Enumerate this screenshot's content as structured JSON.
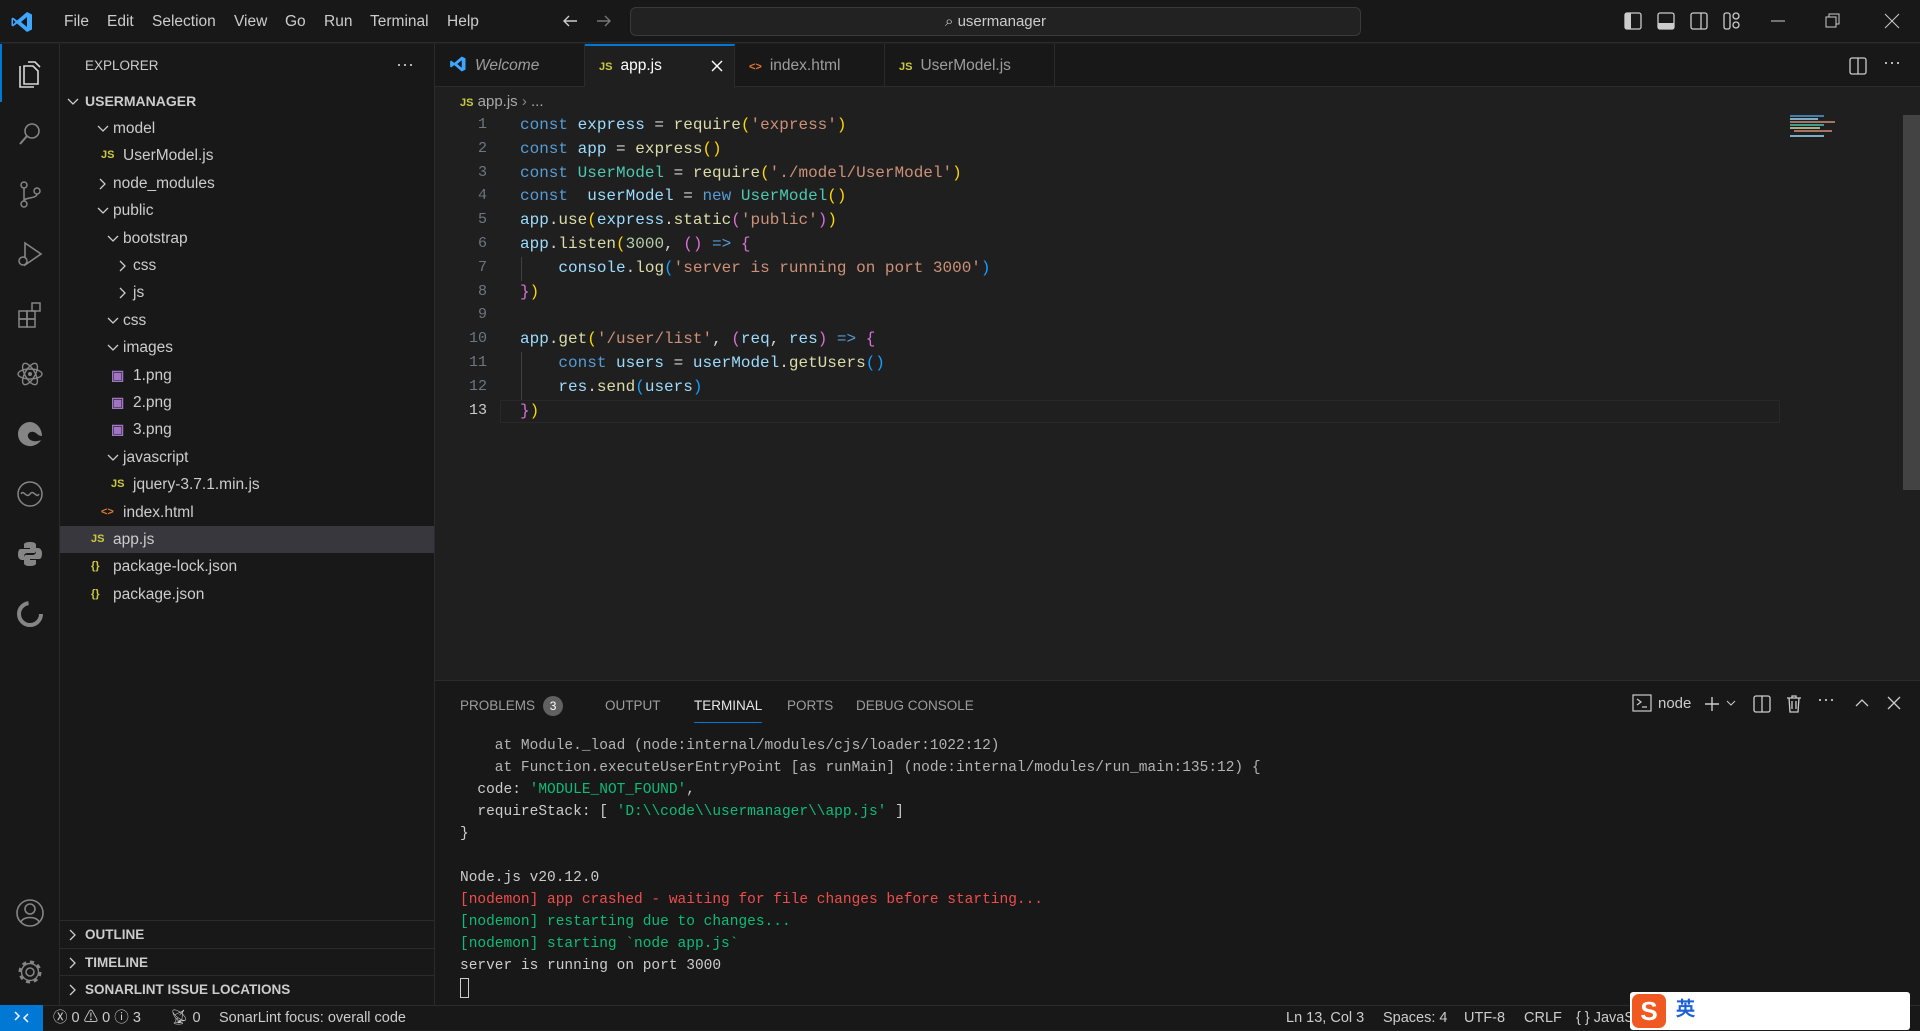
{
  "titlebar": {
    "menu": [
      "File",
      "Edit",
      "Selection",
      "View",
      "Go",
      "Run",
      "Terminal",
      "Help"
    ],
    "search": "usermanager"
  },
  "activity": [
    "explorer-icon",
    "search-icon",
    "source-control-icon",
    "run-debug-icon",
    "extensions-icon",
    "react-icon",
    "edge-icon",
    "live-share-icon",
    "python-icon",
    "sonarlint-icon"
  ],
  "sidebar": {
    "title": "EXPLORER",
    "root": "USERMANAGER",
    "items": [
      {
        "label": "model",
        "depth": 1,
        "type": "folder",
        "open": true
      },
      {
        "label": "UserModel.js",
        "depth": 2,
        "type": "js"
      },
      {
        "label": "node_modules",
        "depth": 1,
        "type": "folder",
        "open": false
      },
      {
        "label": "public",
        "depth": 1,
        "type": "folder",
        "open": true
      },
      {
        "label": "bootstrap",
        "depth": 2,
        "type": "folder",
        "open": true
      },
      {
        "label": "css",
        "depth": 3,
        "type": "folder",
        "open": false
      },
      {
        "label": "js",
        "depth": 3,
        "type": "folder",
        "open": false
      },
      {
        "label": "css",
        "depth": 2,
        "type": "folder",
        "open": true
      },
      {
        "label": "images",
        "depth": 2,
        "type": "folder",
        "open": true
      },
      {
        "label": "1.png",
        "depth": 3,
        "type": "png"
      },
      {
        "label": "2.png",
        "depth": 3,
        "type": "png"
      },
      {
        "label": "3.png",
        "depth": 3,
        "type": "png"
      },
      {
        "label": "javascript",
        "depth": 2,
        "type": "folder",
        "open": true
      },
      {
        "label": "jquery-3.7.1.min.js",
        "depth": 3,
        "type": "js"
      },
      {
        "label": "index.html",
        "depth": 2,
        "type": "html"
      },
      {
        "label": "app.js",
        "depth": 1,
        "type": "js",
        "selected": true
      },
      {
        "label": "package-lock.json",
        "depth": 1,
        "type": "json"
      },
      {
        "label": "package.json",
        "depth": 1,
        "type": "json"
      }
    ],
    "sections": [
      "OUTLINE",
      "TIMELINE",
      "SONARLINT ISSUE LOCATIONS"
    ]
  },
  "tabs": [
    {
      "label": "Welcome",
      "type": "vscode"
    },
    {
      "label": "app.js",
      "type": "js",
      "active": true
    },
    {
      "label": "index.html",
      "type": "html"
    },
    {
      "label": "UserModel.js",
      "type": "js"
    }
  ],
  "breadcrumb": {
    "file": "app.js",
    "rest": "..."
  },
  "editor": {
    "current_line": 13,
    "lines": [
      [
        [
          "const ",
          "k"
        ],
        [
          "express",
          "v"
        ],
        [
          " = ",
          "o"
        ],
        [
          "require",
          "f"
        ],
        [
          "(",
          "p1"
        ],
        [
          "'express'",
          "s"
        ],
        [
          ")",
          "p1"
        ]
      ],
      [
        [
          "const ",
          "k"
        ],
        [
          "app",
          "v"
        ],
        [
          " = ",
          "o"
        ],
        [
          "express",
          "f"
        ],
        [
          "()",
          "p1"
        ]
      ],
      [
        [
          "const ",
          "k"
        ],
        [
          "UserModel",
          "c"
        ],
        [
          " = ",
          "o"
        ],
        [
          "require",
          "f"
        ],
        [
          "(",
          "p1"
        ],
        [
          "'./model/UserModel'",
          "s"
        ],
        [
          ")",
          "p1"
        ]
      ],
      [
        [
          "const  ",
          "k"
        ],
        [
          "userModel",
          "v"
        ],
        [
          " = ",
          "o"
        ],
        [
          "new ",
          "k"
        ],
        [
          "UserModel",
          "c"
        ],
        [
          "()",
          "p1"
        ]
      ],
      [
        [
          "app",
          "v"
        ],
        [
          ".",
          "o"
        ],
        [
          "use",
          "f"
        ],
        [
          "(",
          "p1"
        ],
        [
          "express",
          "v"
        ],
        [
          ".",
          "o"
        ],
        [
          "static",
          "f"
        ],
        [
          "(",
          "p2"
        ],
        [
          "'public'",
          "s"
        ],
        [
          ")",
          "p2"
        ],
        [
          ")",
          "p1"
        ]
      ],
      [
        [
          "app",
          "v"
        ],
        [
          ".",
          "o"
        ],
        [
          "listen",
          "f"
        ],
        [
          "(",
          "p1"
        ],
        [
          "3000",
          "n"
        ],
        [
          ", ",
          "o"
        ],
        [
          "()",
          "p2"
        ],
        [
          " => ",
          "k"
        ],
        [
          "{",
          "p2"
        ]
      ],
      [
        [
          "    console",
          "v"
        ],
        [
          ".",
          "o"
        ],
        [
          "log",
          "f"
        ],
        [
          "(",
          "p3"
        ],
        [
          "'server is running on port 3000'",
          "s"
        ],
        [
          ")",
          "p3"
        ]
      ],
      [
        [
          "}",
          "p2"
        ],
        [
          ")",
          "p1"
        ]
      ],
      [],
      [
        [
          "app",
          "v"
        ],
        [
          ".",
          "o"
        ],
        [
          "get",
          "f"
        ],
        [
          "(",
          "p1"
        ],
        [
          "'/user/list'",
          "s"
        ],
        [
          ", ",
          "o"
        ],
        [
          "(",
          "p2"
        ],
        [
          "req",
          "v"
        ],
        [
          ", ",
          "o"
        ],
        [
          "res",
          "v"
        ],
        [
          ")",
          "p2"
        ],
        [
          " => ",
          "k"
        ],
        [
          "{",
          "p2"
        ]
      ],
      [
        [
          "    const ",
          "k"
        ],
        [
          "users",
          "v"
        ],
        [
          " = ",
          "o"
        ],
        [
          "userModel",
          "v"
        ],
        [
          ".",
          "o"
        ],
        [
          "getUsers",
          "f"
        ],
        [
          "()",
          "p3"
        ]
      ],
      [
        [
          "    res",
          "v"
        ],
        [
          ".",
          "o"
        ],
        [
          "send",
          "f"
        ],
        [
          "(",
          "p3"
        ],
        [
          "users",
          "v"
        ],
        [
          ")",
          "p3"
        ]
      ],
      [
        [
          "}",
          "p2"
        ],
        [
          ")",
          "p1"
        ]
      ]
    ]
  },
  "panel": {
    "tabs": [
      "PROBLEMS",
      "OUTPUT",
      "TERMINAL",
      "PORTS",
      "DEBUG CONSOLE"
    ],
    "problems_count": "3",
    "active": "TERMINAL",
    "terminal_name": "node",
    "lines": [
      [
        [
          "    at Module._load (node:internal/modules/cjs/loader:1022:12)",
          "t-dim"
        ]
      ],
      [
        [
          "    at Function.executeUserEntryPoint [as runMain] (node:internal/modules/run_main:135:12) {",
          "t-dim"
        ]
      ],
      [
        [
          "  code: ",
          ""
        ],
        [
          "'MODULE_NOT_FOUND'",
          "t-g2"
        ],
        [
          ",",
          ""
        ]
      ],
      [
        [
          "  requireStack: [ ",
          ""
        ],
        [
          "'D:\\\\code\\\\usermanager\\\\app.js'",
          "t-g2"
        ],
        [
          " ]",
          ""
        ]
      ],
      [
        [
          "}",
          ""
        ]
      ],
      [],
      [
        [
          "Node.js v20.12.0",
          ""
        ]
      ],
      [
        [
          "[nodemon] app crashed - waiting for file changes before starting...",
          "t-red"
        ]
      ],
      [
        [
          "[nodemon] restarting due to changes...",
          "t-g2"
        ]
      ],
      [
        [
          "[nodemon] starting `node app.js`",
          "t-g2"
        ]
      ],
      [
        [
          "server is running on port 3000",
          ""
        ]
      ]
    ]
  },
  "status": {
    "errors": "0",
    "warnings": "0",
    "infos": "3",
    "ports": "0",
    "sonar": "SonarLint focus: overall code",
    "position": "Ln 13, Col 3",
    "spaces": "Spaces: 4",
    "encoding": "UTF-8",
    "eol": "CRLF",
    "language": "{ } JavaS",
    "ime": "英"
  },
  "colors": {
    "accent": "#0078d4",
    "js": "#cbcb41",
    "html": "#e37933",
    "png": "#a074c4"
  }
}
